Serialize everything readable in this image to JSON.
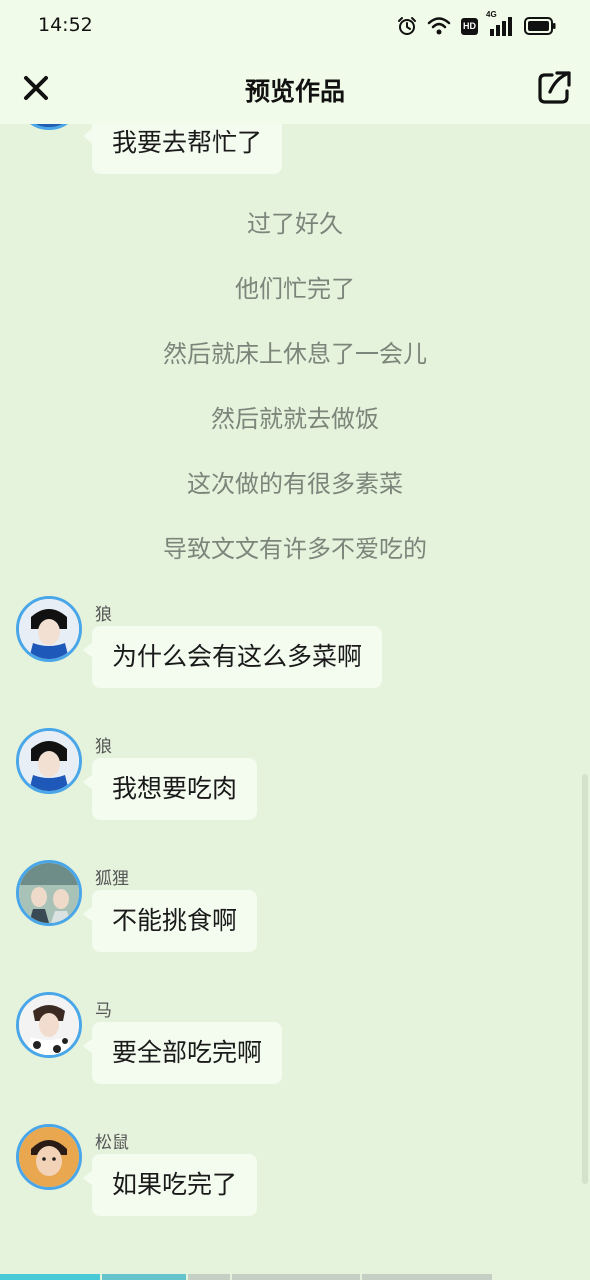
{
  "status_bar": {
    "time": "14:52",
    "hd_badge": "HD",
    "network_type": "4G",
    "icons": [
      "alarm-icon",
      "wifi-icon",
      "hd-icon",
      "signal-icon",
      "battery-icon"
    ]
  },
  "header": {
    "title": "预览作品",
    "close_icon": "close-icon",
    "share_icon": "share-icon"
  },
  "chat": {
    "top_message": {
      "text": "我要去帮忙了"
    },
    "narration": [
      "过了好久",
      "他们忙完了",
      "然后就床上休息了一会儿",
      "然后就就去做饭",
      "这次做的有很多素菜",
      "导致文文有许多不爱吃的"
    ],
    "messages": [
      {
        "sender": "狼",
        "text": "为什么会有这么多菜啊"
      },
      {
        "sender": "狼",
        "text": "我想要吃肉"
      },
      {
        "sender": "狐狸",
        "text": "不能挑食啊"
      },
      {
        "sender": "马",
        "text": "要全部吃完啊"
      },
      {
        "sender": "松鼠",
        "text": "如果吃完了"
      }
    ]
  },
  "colors": {
    "background": "#e5f3dd",
    "header_background": "#f1fbe9",
    "bubble": "#f4fbef",
    "avatar_border": "#49a6e9",
    "narration_text": "#7c857a",
    "progress_active": "#47c9d8"
  }
}
